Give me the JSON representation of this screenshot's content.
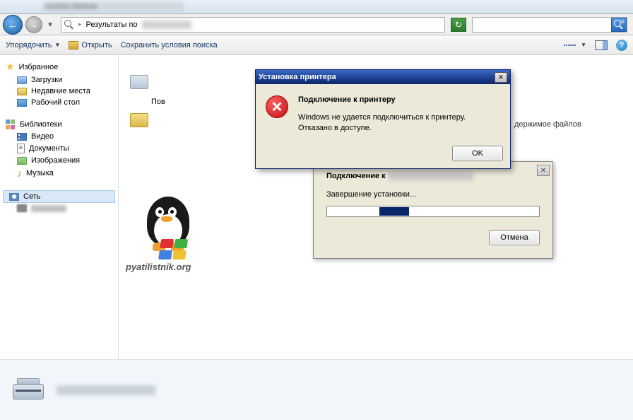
{
  "titlebar": {
    "fragment": "льтаты поиска"
  },
  "nav": {
    "address_label": "Результаты по",
    "search_placeholder": ""
  },
  "toolbar": {
    "organize": "Упорядочить",
    "open": "Открыть",
    "save_search": "Сохранить условия поиска"
  },
  "sidebar": {
    "favorites": {
      "header": "Избранное",
      "items": [
        "Загрузки",
        "Недавние места",
        "Рабочий стол"
      ]
    },
    "libraries": {
      "header": "Библиотеки",
      "items": [
        "Видео",
        "Документы",
        "Изображения",
        "Музыка"
      ]
    },
    "network": {
      "header": "Сеть"
    }
  },
  "content": {
    "row1_prefix": "Пов",
    "row2_suffix": "держимое файлов"
  },
  "watermark": {
    "text": "pyatilistnik.org"
  },
  "progress_dialog": {
    "connecting_to": "Подключение к",
    "status": "Завершение установки...",
    "cancel": "Отмена"
  },
  "error_dialog": {
    "title": "Установка принтера",
    "heading": "Подключение к принтеру",
    "line1": "Windows не удается подключиться к принтеру.",
    "line2": "Отказано в доступе.",
    "ok": "OK"
  }
}
